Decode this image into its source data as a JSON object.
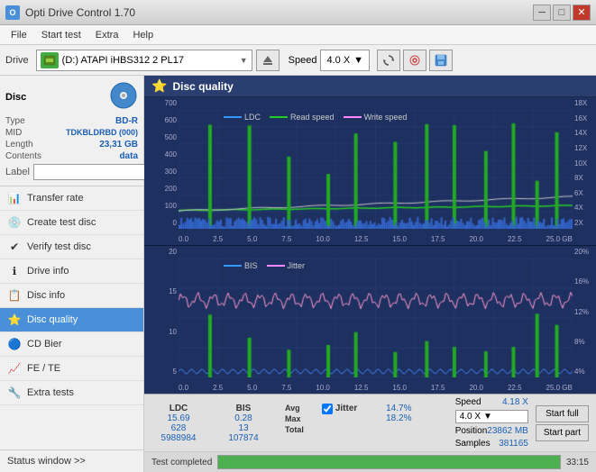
{
  "app": {
    "title": "Opti Drive Control 1.70",
    "icon_label": "O"
  },
  "title_controls": {
    "minimize": "─",
    "maximize": "□",
    "close": "✕"
  },
  "menu": {
    "items": [
      "File",
      "Start test",
      "Extra",
      "Help"
    ]
  },
  "toolbar": {
    "drive_label": "Drive",
    "drive_value": "(D:) ATAPI iHBS312  2 PL17",
    "speed_label": "Speed",
    "speed_value": "4.0 X"
  },
  "disc": {
    "title": "Disc",
    "type_label": "Type",
    "type_value": "BD-R",
    "mid_label": "MID",
    "mid_value": "TDKBLDRBD (000)",
    "length_label": "Length",
    "length_value": "23,31 GB",
    "contents_label": "Contents",
    "contents_value": "data",
    "label_label": "Label",
    "label_value": ""
  },
  "nav": {
    "items": [
      {
        "id": "transfer-rate",
        "label": "Transfer rate",
        "icon": "📊"
      },
      {
        "id": "create-test-disc",
        "label": "Create test disc",
        "icon": "💿"
      },
      {
        "id": "verify-test-disc",
        "label": "Verify test disc",
        "icon": "✔"
      },
      {
        "id": "drive-info",
        "label": "Drive info",
        "icon": "ℹ"
      },
      {
        "id": "disc-info",
        "label": "Disc info",
        "icon": "📋"
      },
      {
        "id": "disc-quality",
        "label": "Disc quality",
        "icon": "⭐",
        "active": true
      },
      {
        "id": "cd-bier",
        "label": "CD Bier",
        "icon": "🔵"
      },
      {
        "id": "fe-te",
        "label": "FE / TE",
        "icon": "📈"
      },
      {
        "id": "extra-tests",
        "label": "Extra tests",
        "icon": "🔧"
      }
    ]
  },
  "status_window": {
    "label": "Status window >>"
  },
  "disc_quality": {
    "title": "Disc quality"
  },
  "chart_top": {
    "legend": [
      {
        "label": "LDC",
        "color": "#3399ff"
      },
      {
        "label": "Read speed",
        "color": "#22cc22"
      },
      {
        "label": "Write speed",
        "color": "#ff88ff"
      }
    ],
    "y_left": [
      "700",
      "600",
      "500",
      "400",
      "300",
      "200",
      "100",
      "0"
    ],
    "y_right": [
      "18X",
      "16X",
      "14X",
      "12X",
      "10X",
      "8X",
      "6X",
      "4X",
      "2X"
    ],
    "x_axis": [
      "0.0",
      "2.5",
      "5.0",
      "7.5",
      "10.0",
      "12.5",
      "15.0",
      "17.5",
      "20.0",
      "22.5",
      "25.0 GB"
    ]
  },
  "chart_bottom": {
    "legend": [
      {
        "label": "BIS",
        "color": "#3399ff"
      },
      {
        "label": "Jitter",
        "color": "#ff88ff"
      }
    ],
    "y_left": [
      "20",
      "15",
      "10",
      "5"
    ],
    "y_right": [
      "20%",
      "16%",
      "12%",
      "8%",
      "4%"
    ],
    "x_axis": [
      "0.0",
      "2.5",
      "5.0",
      "7.5",
      "10.0",
      "12.5",
      "15.0",
      "17.5",
      "20.0",
      "22.5",
      "25.0 GB"
    ]
  },
  "stats": {
    "ldc_label": "LDC",
    "bis_label": "BIS",
    "jitter_label": "Jitter",
    "jitter_checked": true,
    "avg_label": "Avg",
    "max_label": "Max",
    "total_label": "Total",
    "ldc_avg": "15.69",
    "ldc_max": "628",
    "ldc_total": "5988984",
    "bis_avg": "0.28",
    "bis_max": "13",
    "bis_total": "107874",
    "jitter_avg": "14.7%",
    "jitter_max": "18.2%",
    "speed_label": "Speed",
    "speed_value": "4.18 X",
    "speed_select": "4.0 X",
    "position_label": "Position",
    "position_value": "23862 MB",
    "samples_label": "Samples",
    "samples_value": "381165",
    "start_full_label": "Start full",
    "start_part_label": "Start part"
  },
  "progress": {
    "status_text": "Test completed",
    "progress_pct": 100,
    "time": "33:15"
  }
}
